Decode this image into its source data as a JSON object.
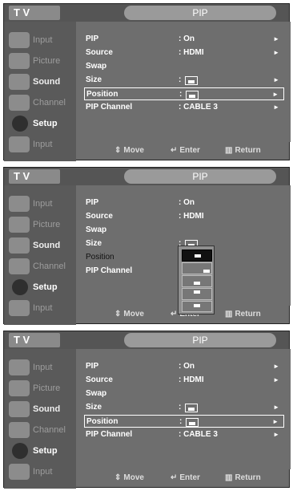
{
  "screens": [
    {
      "app": "T V",
      "menu_title": "PIP",
      "sidebar": [
        "Input",
        "Picture",
        "Sound",
        "Channel",
        "Setup",
        "Input"
      ],
      "rows": [
        {
          "label": "PIP",
          "value": ": On",
          "arrow": "►"
        },
        {
          "label": "Source",
          "value": ": HDMI",
          "arrow": "►"
        },
        {
          "label": "Swap",
          "value": "",
          "arrow": ""
        },
        {
          "label": "Size",
          "value": ":",
          "arrow": "►"
        },
        {
          "label": "Position",
          "value": ":",
          "arrow": "►"
        },
        {
          "label": "PIP Channel",
          "value": ": CABLE 3",
          "arrow": "►"
        }
      ],
      "hints": {
        "move": "Move",
        "enter": "Enter",
        "return": "Return"
      }
    },
    {
      "app": "T V",
      "menu_title": "PIP",
      "sidebar": [
        "Input",
        "Picture",
        "Sound",
        "Channel",
        "Setup",
        "Input"
      ],
      "rows": [
        {
          "label": "PIP",
          "value": ": On",
          "arrow": ""
        },
        {
          "label": "Source",
          "value": ": HDMI",
          "arrow": ""
        },
        {
          "label": "Swap",
          "value": "",
          "arrow": ""
        },
        {
          "label": "Size",
          "value": ":",
          "arrow": ""
        },
        {
          "label": "Position",
          "value": ":",
          "arrow": ""
        },
        {
          "label": "PIP Channel",
          "value": ":",
          "arrow": ""
        }
      ],
      "hints": {
        "move": "Move",
        "enter": "Enter",
        "return": "Return"
      }
    },
    {
      "app": "T V",
      "menu_title": "PIP",
      "sidebar": [
        "Input",
        "Picture",
        "Sound",
        "Channel",
        "Setup",
        "Input"
      ],
      "rows": [
        {
          "label": "PIP",
          "value": ": On",
          "arrow": "►"
        },
        {
          "label": "Source",
          "value": ": HDMI",
          "arrow": "►"
        },
        {
          "label": "Swap",
          "value": "",
          "arrow": ""
        },
        {
          "label": "Size",
          "value": ":",
          "arrow": "►"
        },
        {
          "label": "Position",
          "value": ":",
          "arrow": "►"
        },
        {
          "label": "PIP Channel",
          "value": ": CABLE 3",
          "arrow": "►"
        }
      ],
      "hints": {
        "move": "Move",
        "enter": "Enter",
        "return": "Return"
      }
    }
  ],
  "icons": {
    "move": "up-down-arrows-icon",
    "enter": "enter-icon",
    "return": "return-icon"
  }
}
